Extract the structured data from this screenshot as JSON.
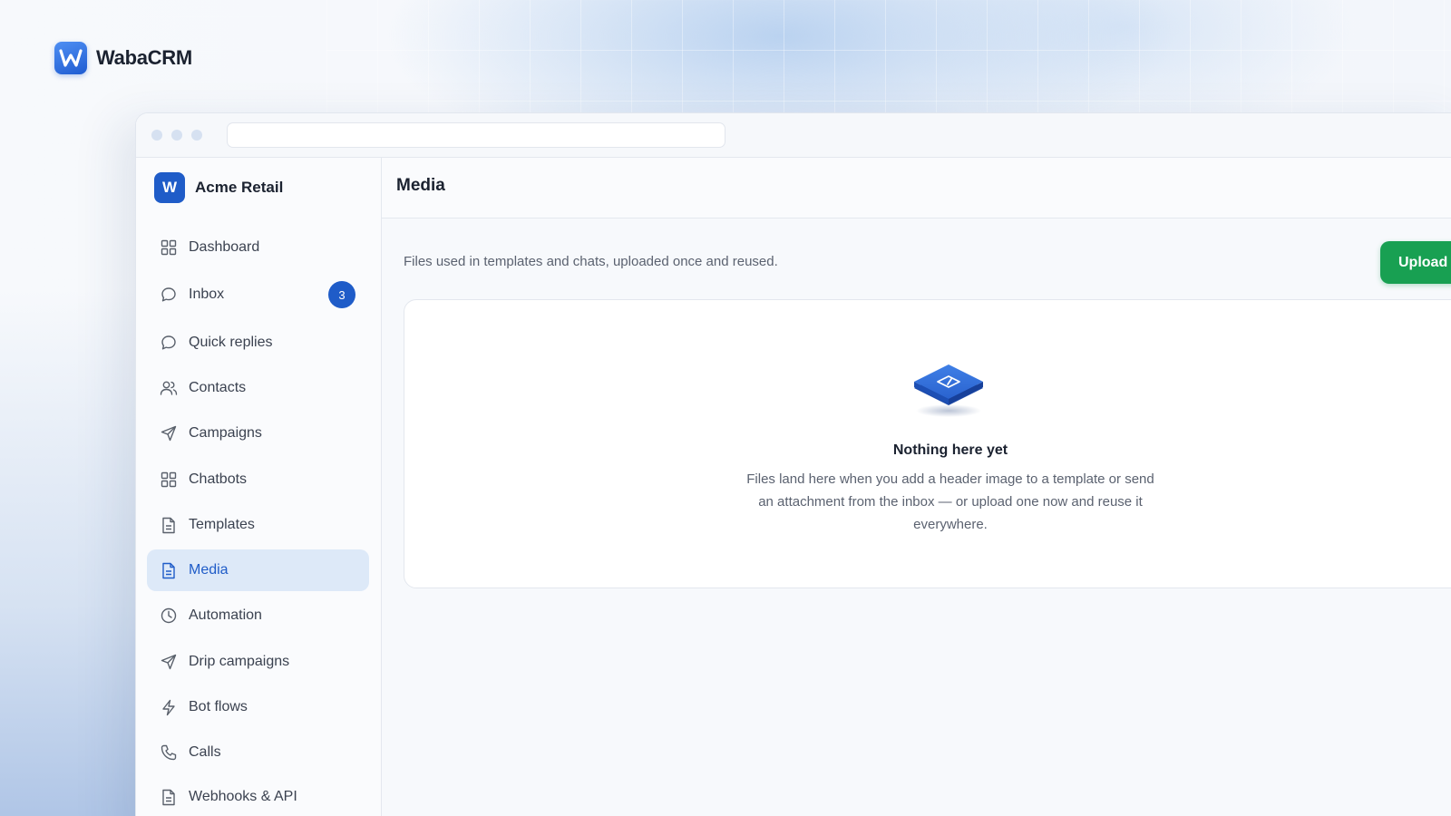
{
  "brand": {
    "name": "WabaCRM",
    "logo_letter": "W",
    "logo_icon": "w-logo-icon"
  },
  "window": {
    "traffic_dots": 3,
    "url": ""
  },
  "sidebar": {
    "org": {
      "avatar_letter": "W",
      "name": "Acme Retail"
    },
    "items": [
      {
        "label": "Dashboard",
        "icon": "grid-icon"
      },
      {
        "label": "Inbox",
        "icon": "chat-bubble-icon",
        "badge": "3"
      },
      {
        "label": "Quick replies",
        "icon": "chat-bubble-icon"
      },
      {
        "label": "Contacts",
        "icon": "users-icon"
      },
      {
        "label": "Campaigns",
        "icon": "send-icon"
      },
      {
        "label": "Chatbots",
        "icon": "grid-icon"
      },
      {
        "label": "Templates",
        "icon": "document-icon"
      },
      {
        "label": "Media",
        "icon": "document-icon",
        "active": true
      },
      {
        "label": "Automation",
        "icon": "clock-icon"
      },
      {
        "label": "Drip campaigns",
        "icon": "send-icon"
      },
      {
        "label": "Bot flows",
        "icon": "bolt-icon"
      },
      {
        "label": "Calls",
        "icon": "phone-icon"
      },
      {
        "label": "Webhooks & API",
        "icon": "document-icon"
      }
    ]
  },
  "main": {
    "title": "Media",
    "subtitle": "Files used in templates and chats, uploaded once and reused.",
    "upload_button": "Upload",
    "empty_state": {
      "icon": "media-tile-icon",
      "title": "Nothing here yet",
      "description": "Files land here when you add a header image to a template or send an attachment from the inbox — or upload one now and reuse it everywhere."
    }
  },
  "colors": {
    "accent": "#1f5cc8",
    "active_bg": "#dde9f8",
    "upload_button": "#18a052",
    "text_primary": "#1b2230",
    "text_muted": "#5b6270"
  }
}
